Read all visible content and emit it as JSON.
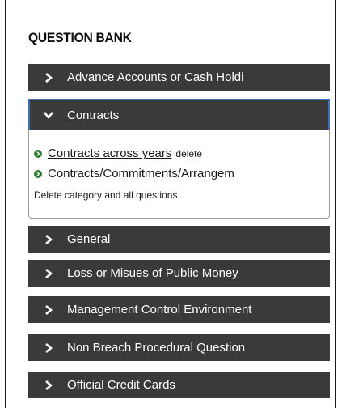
{
  "panel_title": "QUESTION BANK",
  "categories": [
    {
      "label": "Advance Accounts or Cash Holdi",
      "expanded": false
    },
    {
      "label": "Contracts",
      "expanded": true
    },
    {
      "label": "General",
      "expanded": false
    },
    {
      "label": "Loss or Misues of Public Money",
      "expanded": false
    },
    {
      "label": "Management Control Environment",
      "expanded": false
    },
    {
      "label": "Non Breach Procedural Question",
      "expanded": false
    },
    {
      "label": "Official Credit Cards",
      "expanded": false
    }
  ],
  "contracts_panel": {
    "items": [
      {
        "label": "Contracts across years",
        "action": "delete"
      },
      {
        "label": "Contracts/Commitments/Arrangem"
      }
    ],
    "delete_category_label": "Delete category and all questions"
  },
  "icons": {
    "collapsed": "chevron-right-icon",
    "expanded": "chevron-down-icon",
    "bullet": "circle-arrow-right-icon"
  },
  "colors": {
    "bar_background": "#3a3a3a",
    "bar_text": "#ffffff",
    "active_border": "#3f6fb5",
    "bullet": "#2e7d32"
  }
}
